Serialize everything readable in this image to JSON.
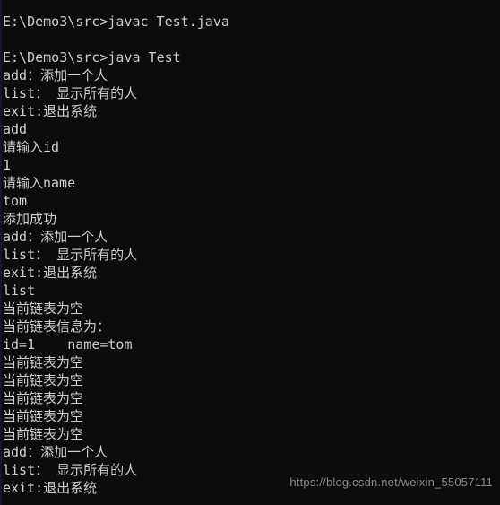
{
  "terminal": {
    "background_color": "#0c0c0c",
    "text_color": "#cfcfcf",
    "left_edge_color": "#12182a",
    "lines": [
      "E:\\Demo3\\src>javac Test.java",
      "",
      "E:\\Demo3\\src>java Test",
      "add：添加一个人",
      "list： 显示所有的人",
      "exit:退出系统",
      "add",
      "请输入id",
      "1",
      "请输入name",
      "tom",
      "添加成功",
      "add：添加一个人",
      "list： 显示所有的人",
      "exit:退出系统",
      "list",
      "当前链表为空",
      "当前链表信息为：",
      "id=1    name=tom",
      "当前链表为空",
      "当前链表为空",
      "当前链表为空",
      "当前链表为空",
      "当前链表为空",
      "add：添加一个人",
      "list： 显示所有的人",
      "exit:退出系统"
    ]
  },
  "watermark": {
    "text": "https://blog.csdn.net/weixin_55057111",
    "color": "#8a8a8a"
  }
}
